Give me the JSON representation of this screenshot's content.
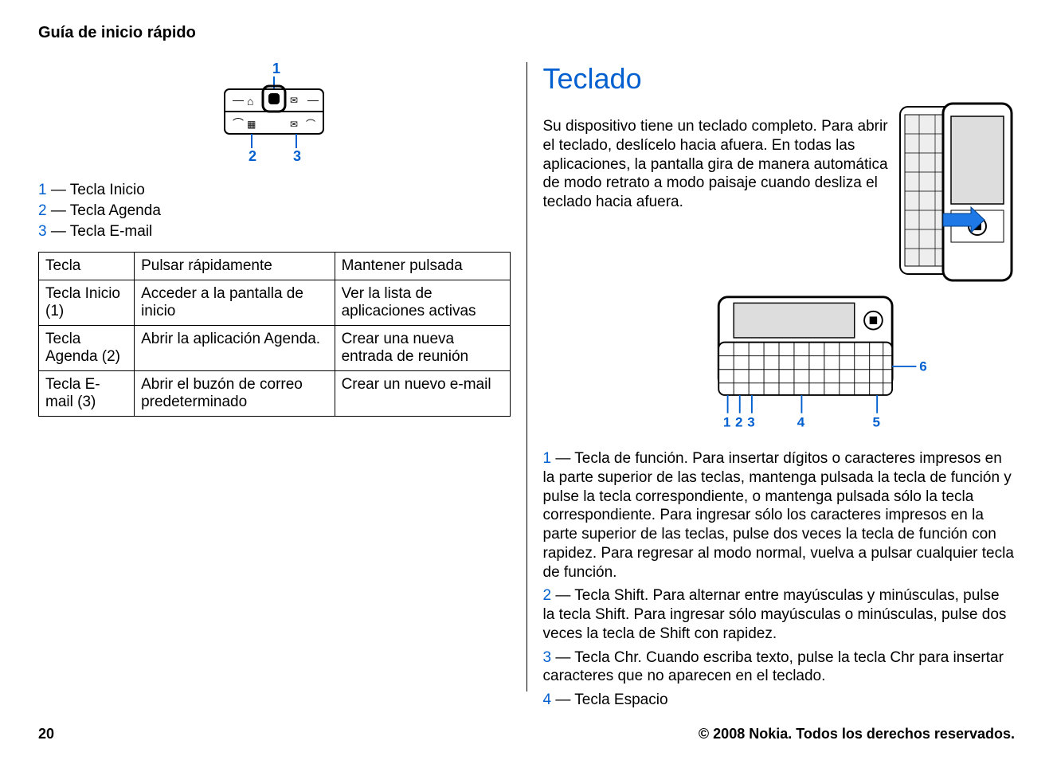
{
  "header": "Guía de inicio rápido",
  "left": {
    "legend": [
      {
        "num": "1",
        "text": " — Tecla Inicio"
      },
      {
        "num": "2",
        "text": " — Tecla Agenda"
      },
      {
        "num": "3",
        "text": " — Tecla E-mail"
      }
    ],
    "table": {
      "headers": [
        "Tecla",
        "Pulsar rápidamente",
        "Mantener pulsada"
      ],
      "rows": [
        [
          "Tecla Inicio (1)",
          "Acceder a la pantalla de inicio",
          "Ver la lista de aplicaciones activas"
        ],
        [
          "Tecla Agenda (2)",
          "Abrir la aplicación Agenda.",
          "Crear una nueva entrada de reunión"
        ],
        [
          "Tecla E-mail (3)",
          "Abrir el buzón de correo predeterminado",
          "Crear un nuevo e-mail"
        ]
      ]
    }
  },
  "right": {
    "title": "Teclado",
    "intro": "Su dispositivo tiene un teclado completo. Para abrir el teclado, deslícelo hacia afuera. En todas las aplicaciones, la pantalla gira de manera automática de modo retrato a modo paisaje cuando desliza el teclado hacia afuera.",
    "items": [
      {
        "num": "1",
        "text": " — Tecla de función. Para insertar dígitos o caracteres impresos en la parte superior de las teclas, mantenga pulsada la tecla de función y pulse la tecla correspondiente, o mantenga pulsada sólo la tecla correspondiente. Para ingresar sólo los caracteres impresos en la parte superior de las teclas, pulse dos veces la tecla de función con rapidez. Para regresar al modo normal, vuelva a pulsar cualquier tecla de función."
      },
      {
        "num": "2",
        "text": " — Tecla Shift. Para alternar entre mayúsculas y minúsculas, pulse la tecla Shift. Para ingresar sólo mayúsculas o minúsculas, pulse dos veces la tecla de Shift con rapidez."
      },
      {
        "num": "3",
        "text": " — Tecla Chr. Cuando escriba texto, pulse la tecla Chr para insertar caracteres que no aparecen en el teclado."
      },
      {
        "num": "4",
        "text": " — Tecla Espacio"
      }
    ]
  },
  "footer": {
    "page": "20",
    "copyright": "© 2008 Nokia. Todos los derechos reservados."
  }
}
